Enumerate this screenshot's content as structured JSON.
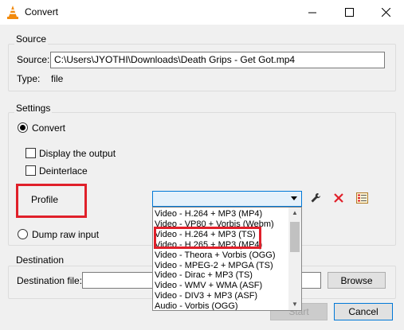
{
  "window": {
    "title": "Convert"
  },
  "source": {
    "group_label": "Source",
    "source_label": "Source:",
    "source_value": "C:\\Users\\JYOTHI\\Downloads\\Death Grips - Get Got.mp4",
    "type_label": "Type:",
    "type_value": "file"
  },
  "settings": {
    "group_label": "Settings",
    "convert_label": "Convert",
    "display_output_label": "Display the output",
    "deinterlace_label": "Deinterlace",
    "profile_label": "Profile",
    "profile_selected": "",
    "dump_raw_label": "Dump raw input",
    "profile_options": [
      "Video - H.264 + MP3 (MP4)",
      "Video - VP80 + Vorbis (Webm)",
      "Video - H.264 + MP3 (TS)",
      "Video - H.265 + MP3 (MP4)",
      "Video - Theora + Vorbis (OGG)",
      "Video - MPEG-2 + MPGA (TS)",
      "Video - Dirac + MP3 (TS)",
      "Video - WMV + WMA (ASF)",
      "Video - DIV3 + MP3 (ASF)",
      "Audio - Vorbis (OGG)"
    ]
  },
  "destination": {
    "group_label": "Destination",
    "file_label": "Destination file:",
    "file_value": "",
    "browse_label": "Browse"
  },
  "footer": {
    "start_label": "Start",
    "cancel_label": "Cancel"
  },
  "colors": {
    "highlight_box": "#e0202a",
    "accent": "#0078d7"
  }
}
